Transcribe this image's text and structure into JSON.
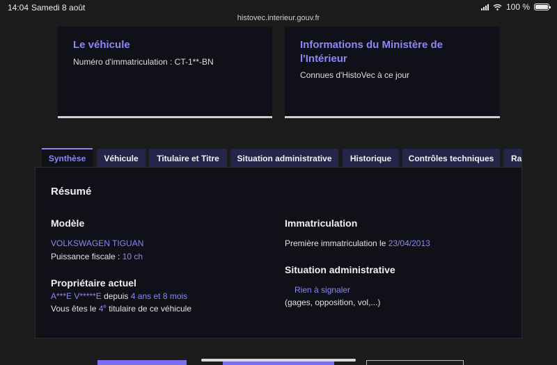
{
  "status": {
    "time": "14:04",
    "date": "Samedi 8 août",
    "battery": "100 %"
  },
  "url": "histovec.interieur.gouv.fr",
  "cards": {
    "vehicle": {
      "title": "Le véhicule",
      "line": "Numéro d'immatriculation : CT-1**-BN"
    },
    "ministry": {
      "title": "Informations du Ministère de l'Intérieur",
      "line": "Connues d'HistoVec à ce jour"
    }
  },
  "tabs": [
    "Synthèse",
    "Véhicule",
    "Titulaire et Titre",
    "Situation administrative",
    "Historique",
    "Contrôles techniques",
    "Rapport"
  ],
  "summary": {
    "title": "Résumé",
    "model": {
      "heading": "Modèle",
      "name": "VOLKSWAGEN TIGUAN",
      "power_label": "Puissance fiscale :",
      "power_value": "10 ch"
    },
    "owner": {
      "heading": "Propriétaire actuel",
      "name": "A***E V*****E",
      "since_label": "depuis",
      "since_value": "4 ans et 8 mois",
      "rank_prefix": "Vous êtes le",
      "rank_value": "4",
      "rank_sup": "e",
      "rank_suffix": "titulaire de ce véhicule"
    },
    "registration": {
      "heading": "Immatriculation",
      "label": "Première immatriculation le",
      "date": "23/04/2013"
    },
    "admin": {
      "heading": "Situation administrative",
      "status": "Rien à signaler",
      "detail": "(gages, opposition, vol,...)"
    }
  },
  "colors": {
    "accent": "#8f86f5",
    "background": "#1b1b1b",
    "card": "#101018",
    "tab": "#25254a"
  }
}
